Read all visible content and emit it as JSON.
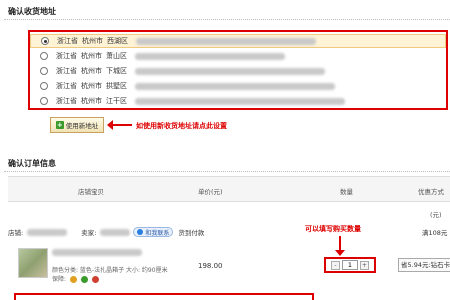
{
  "address_section": {
    "title": "确认收货地址",
    "addresses": [
      {
        "province": "浙江省",
        "city": "杭州市",
        "district": "西湖区",
        "selected": true
      },
      {
        "province": "浙江省",
        "city": "杭州市",
        "district": "萧山区",
        "selected": false
      },
      {
        "province": "浙江省",
        "city": "杭州市",
        "district": "下城区",
        "selected": false
      },
      {
        "province": "浙江省",
        "city": "杭州市",
        "district": "拱墅区",
        "selected": false
      },
      {
        "province": "浙江省",
        "city": "杭州市",
        "district": "江干区",
        "selected": false
      }
    ],
    "new_address_button": "使用新地址",
    "new_address_hint": "如使用新收货地址请点此设置"
  },
  "order_section": {
    "title": "确认订单信息",
    "columns": [
      "店铺宝贝",
      "单价(元)",
      "数量",
      "优惠方式"
    ],
    "columns_extra": "(元)",
    "shop_label": "店铺:",
    "seller_label": "卖家:",
    "contact_button": "和我联系",
    "payment_note": "货到付款",
    "right_clip": "满108元",
    "qty_hint": "可以填写购买数量",
    "product": {
      "attributes": "颜色分类: 蓝色-法扎晶箱子   大小: 约90厘米",
      "guarantee_label": "保障:",
      "price": "198.00",
      "quantity": "1",
      "qty_minus": "-",
      "qty_plus": "+",
      "discount": "省5.94元:钻石卡"
    }
  },
  "colors": {
    "accent_red": "#dd0000",
    "link_blue": "#2a5aa8"
  }
}
